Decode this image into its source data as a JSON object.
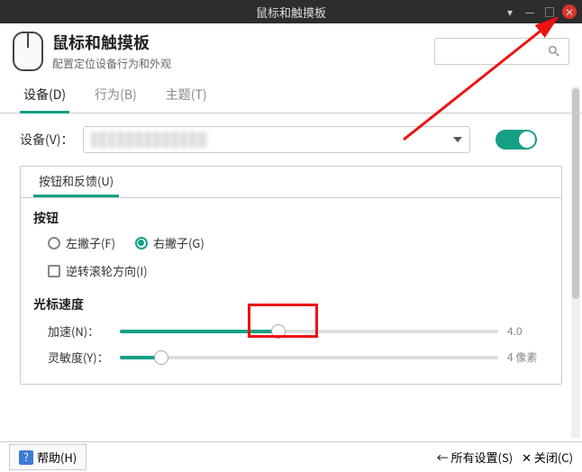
{
  "window": {
    "title": "鼠标和触摸板"
  },
  "header": {
    "title": "鼠标和触摸板",
    "subtitle": "配置定位设备行为和外观"
  },
  "tabs": {
    "devices": "设备(D)",
    "behavior": "行为(B)",
    "theme": "主题(T)"
  },
  "device_row": {
    "label": "设备(V)："
  },
  "panel": {
    "tab": "按钮和反馈(U)",
    "buttons_title": "按钮",
    "left_handed": "左撇子(F)",
    "right_handed": "右撇子(G)",
    "reverse_scroll": "逆转滚轮方向(I)",
    "speed_title": "光标速度",
    "accel_label": "加速(N)：",
    "accel_value": "4.0",
    "accel_percent": 42,
    "sens_label": "灵敏度(Y)：",
    "sens_value": "4 像素",
    "sens_percent": 11
  },
  "footer": {
    "help": "帮助(H)",
    "all_settings": "所有设置(S)",
    "close": "关闭(C)"
  }
}
